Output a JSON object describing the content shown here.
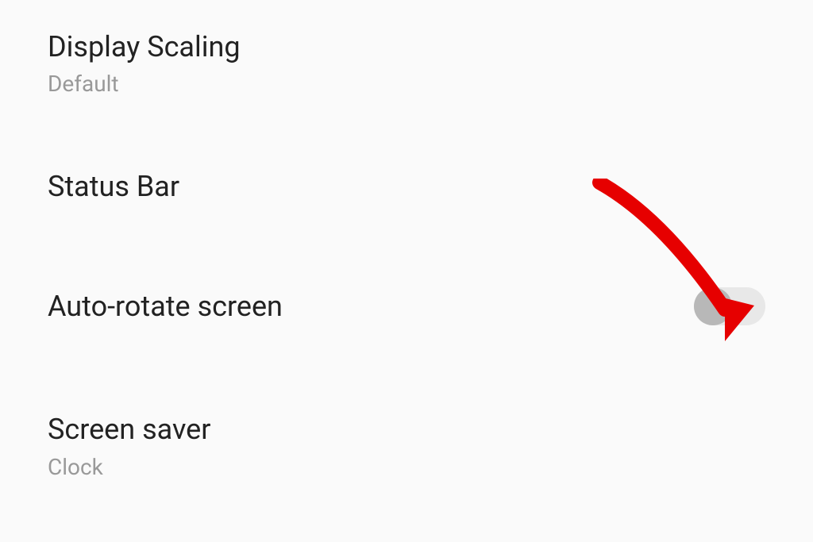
{
  "settings": {
    "display_scaling": {
      "title": "Display Scaling",
      "subtitle": "Default"
    },
    "status_bar": {
      "title": "Status Bar"
    },
    "auto_rotate": {
      "title": "Auto-rotate screen",
      "enabled": false
    },
    "screen_saver": {
      "title": "Screen saver",
      "subtitle": "Clock"
    }
  },
  "annotation": {
    "arrow_color": "#e60000"
  }
}
